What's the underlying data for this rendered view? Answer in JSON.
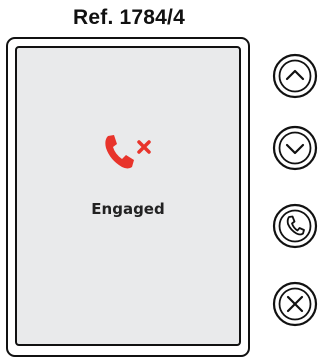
{
  "header": {
    "reference": "Ref. 1784/4"
  },
  "screen": {
    "status_label": "Engaged",
    "status_icon": "phone-busy-icon"
  },
  "buttons": [
    {
      "name": "up-button",
      "icon": "chevron-up-icon"
    },
    {
      "name": "down-button",
      "icon": "chevron-down-icon"
    },
    {
      "name": "call-button",
      "icon": "phone-icon"
    },
    {
      "name": "cancel-button",
      "icon": "close-x-icon"
    }
  ],
  "colors": {
    "screen_background": "#e9eaeb",
    "alert_red": "#e8342b",
    "outline": "#111111"
  }
}
